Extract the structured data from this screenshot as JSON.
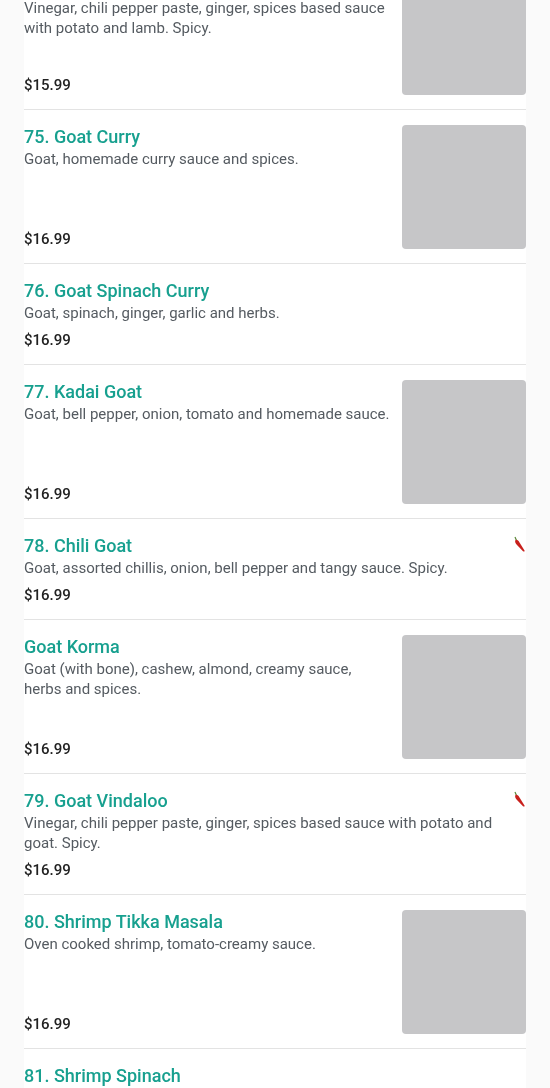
{
  "menu_items": [
    {
      "description": "Vinegar, chili pepper paste, ginger, spices based sauce with potato and lamb. Spicy.",
      "price": "$15.99",
      "has_image": true,
      "spicy": false
    },
    {
      "name": "75. Goat Curry",
      "description": "Goat, homemade curry sauce and spices.",
      "price": "$16.99",
      "has_image": true,
      "spicy": false
    },
    {
      "name": "76. Goat Spinach Curry",
      "description": "Goat, spinach, ginger, garlic and herbs.",
      "price": "$16.99",
      "has_image": false,
      "spicy": false
    },
    {
      "name": "77. Kadai Goat",
      "description": "Goat, bell pepper, onion, tomato and homemade sauce.",
      "price": "$16.99",
      "has_image": true,
      "spicy": false
    },
    {
      "name": "78. Chili Goat",
      "description": "Goat, assorted chillis, onion, bell pepper and tangy sauce. Spicy.",
      "price": "$16.99",
      "has_image": false,
      "spicy": true
    },
    {
      "name": "Goat Korma",
      "description": "Goat (with bone), cashew, almond, creamy sauce, herbs and spices.",
      "price": "$16.99",
      "has_image": true,
      "spicy": false
    },
    {
      "name": "79. Goat Vindaloo",
      "description": "Vinegar, chili pepper paste, ginger, spices based sauce with potato and goat. Spicy.",
      "price": "$16.99",
      "has_image": false,
      "spicy": true
    },
    {
      "name": "80. Shrimp Tikka Masala",
      "description": "Oven cooked shrimp, tomato-creamy sauce.",
      "price": "$16.99",
      "has_image": true,
      "spicy": false
    },
    {
      "name": "81. Shrimp Spinach"
    }
  ]
}
